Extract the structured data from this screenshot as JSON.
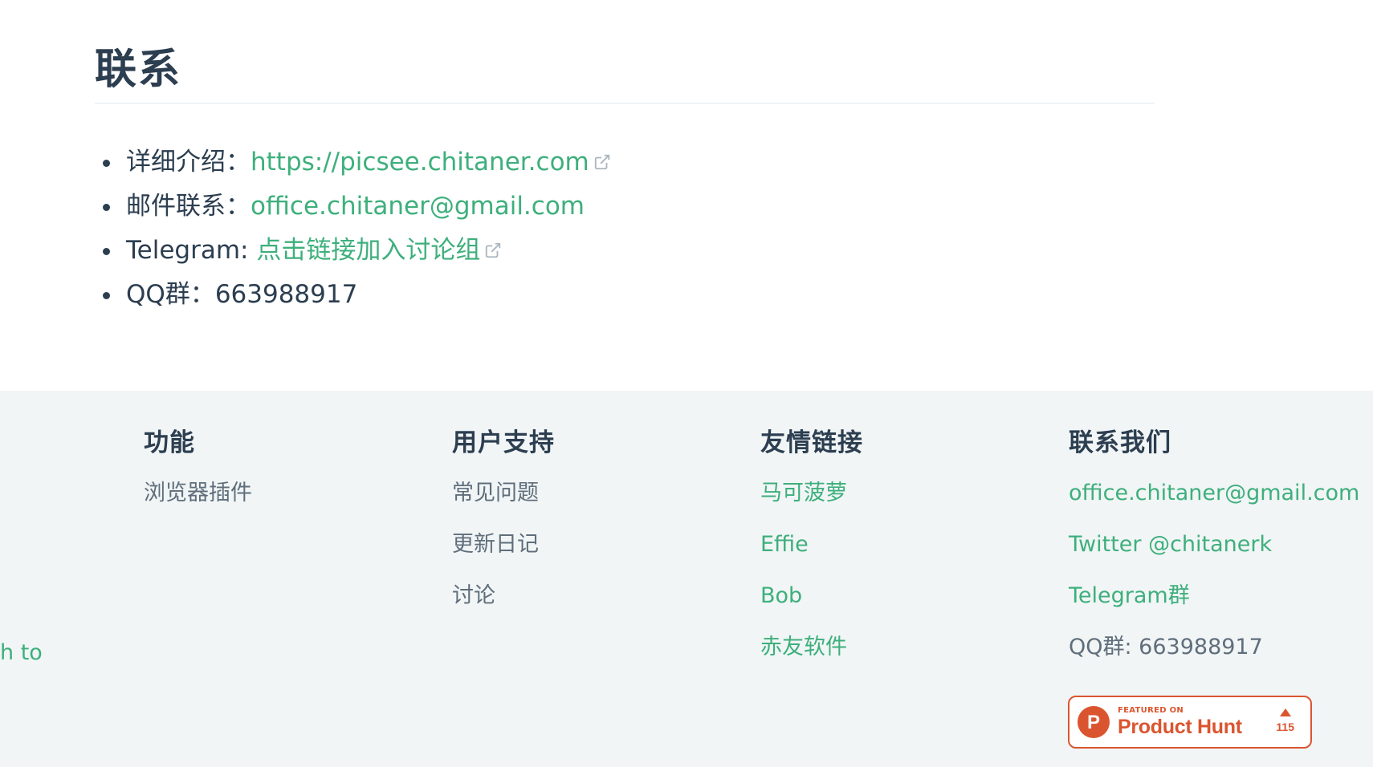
{
  "contact": {
    "heading": "联系",
    "items": [
      {
        "label": "详细介绍：",
        "link": "https://picsee.chitaner.com",
        "external": true
      },
      {
        "label": "邮件联系：",
        "link": "office.chitaner@gmail.com",
        "external": false
      },
      {
        "label": "Telegram: ",
        "link": "点击链接加入讨论组",
        "external": true
      },
      {
        "label": "QQ群：",
        "value": "663988917"
      }
    ]
  },
  "footer": {
    "stray_text": "h to",
    "columns": [
      {
        "title": "功能",
        "items": [
          "浏览器插件"
        ]
      },
      {
        "title": "用户支持",
        "items": [
          "常见问题",
          "更新日记",
          "讨论"
        ]
      },
      {
        "title": "友情链接",
        "items": [
          "马可菠萝",
          "Effie",
          "Bob",
          "赤友软件"
        ]
      },
      {
        "title": "联系我们",
        "items": [
          "office.chitaner@gmail.com",
          "Twitter @chitanerk",
          "Telegram群"
        ],
        "static_text": "QQ群: 663988917"
      }
    ],
    "product_hunt": {
      "featured_on": "FEATURED ON",
      "name": "Product Hunt",
      "logo_letter": "P",
      "votes": "115",
      "color": "#da552f"
    }
  },
  "colors": {
    "accent": "#3eaf7c",
    "text": "#2c3e50",
    "muted": "#606e7b",
    "footer_bg": "#f1f5f6"
  }
}
